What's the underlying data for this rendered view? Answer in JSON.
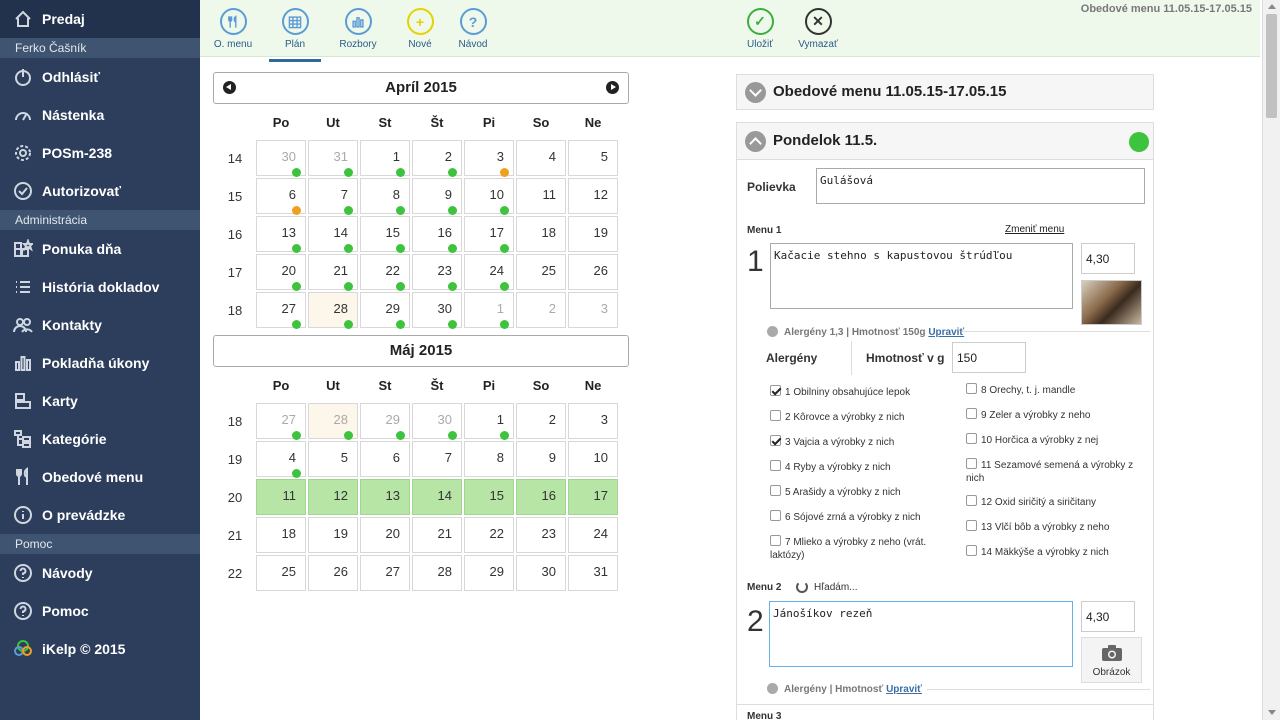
{
  "sidebar": {
    "items": [
      {
        "label": "Predaj",
        "icon": "home-icon"
      },
      {
        "section": "Ferko Čašník"
      },
      {
        "label": "Odhlásiť",
        "icon": "power-icon"
      },
      {
        "label": "Nástenka",
        "icon": "dashboard-icon"
      },
      {
        "label": "POSm-238",
        "icon": "gear-icon"
      },
      {
        "label": "Autorizovať",
        "icon": "check-circle-icon"
      },
      {
        "section": "Administrácia"
      },
      {
        "label": "Ponuka dňa",
        "icon": "blocks-star-icon"
      },
      {
        "label": "História dokladov",
        "icon": "list-icon"
      },
      {
        "label": "Kontakty",
        "icon": "users-icon"
      },
      {
        "label": "Pokladňa úkony",
        "icon": "bar-chart-icon"
      },
      {
        "label": "Karty",
        "icon": "cards-icon"
      },
      {
        "label": "Kategórie",
        "icon": "tree-icon"
      },
      {
        "label": "Obedové menu",
        "icon": "cutlery-icon"
      },
      {
        "label": "O prevádzke",
        "icon": "info-icon"
      },
      {
        "section": "Pomoc"
      },
      {
        "label": "Návody",
        "icon": "question-icon"
      },
      {
        "label": "Pomoc",
        "icon": "question-icon"
      },
      {
        "label": "iKelp © 2015",
        "icon": "ikelp-logo-icon"
      }
    ]
  },
  "toolbar": {
    "buttons": [
      {
        "label": "O. menu",
        "icon": "cutlery-icon",
        "color": "#5c9bd6"
      },
      {
        "label": "Plán",
        "icon": "calendar-icon",
        "color": "#5c9bd6",
        "active": true
      },
      {
        "label": "Rozbory",
        "icon": "bar-chart-icon",
        "color": "#5c9bd6"
      },
      {
        "label": "Nové",
        "icon": "plus-icon",
        "color": "#e5d200"
      },
      {
        "label": "Návod",
        "icon": "question-icon",
        "color": "#5c9bd6"
      },
      {
        "label": "Uložiť",
        "icon": "check-icon",
        "color": "#3dae3d"
      },
      {
        "label": "Vymazať",
        "icon": "close-icon",
        "color": "#333333"
      }
    ],
    "title": "Obedové menu 11.05.15-17.05.15"
  },
  "calendar": {
    "weekdays": [
      "Po",
      "Ut",
      "St",
      "Št",
      "Pi",
      "So",
      "Ne"
    ],
    "months": [
      {
        "title": "Apríl 2015",
        "weeks": [
          {
            "no": "14",
            "days": [
              {
                "d": "30",
                "other": true,
                "dot": "green"
              },
              {
                "d": "31",
                "other": true,
                "dot": "green"
              },
              {
                "d": "1",
                "dot": "green"
              },
              {
                "d": "2",
                "dot": "green"
              },
              {
                "d": "3",
                "dot": "orange"
              },
              {
                "d": "4"
              },
              {
                "d": "5"
              }
            ]
          },
          {
            "no": "15",
            "days": [
              {
                "d": "6",
                "dot": "orange"
              },
              {
                "d": "7",
                "dot": "green"
              },
              {
                "d": "8",
                "dot": "green"
              },
              {
                "d": "9",
                "dot": "green"
              },
              {
                "d": "10",
                "dot": "green"
              },
              {
                "d": "11"
              },
              {
                "d": "12"
              }
            ]
          },
          {
            "no": "16",
            "days": [
              {
                "d": "13",
                "dot": "green"
              },
              {
                "d": "14",
                "dot": "green"
              },
              {
                "d": "15",
                "dot": "green"
              },
              {
                "d": "16",
                "dot": "green"
              },
              {
                "d": "17",
                "dot": "green"
              },
              {
                "d": "18"
              },
              {
                "d": "19"
              }
            ]
          },
          {
            "no": "17",
            "days": [
              {
                "d": "20",
                "dot": "green"
              },
              {
                "d": "21",
                "dot": "green"
              },
              {
                "d": "22",
                "dot": "green"
              },
              {
                "d": "23",
                "dot": "green"
              },
              {
                "d": "24",
                "dot": "green"
              },
              {
                "d": "25"
              },
              {
                "d": "26"
              }
            ]
          },
          {
            "no": "18",
            "days": [
              {
                "d": "27",
                "dot": "green"
              },
              {
                "d": "28",
                "today": true,
                "dot": "green"
              },
              {
                "d": "29",
                "dot": "green"
              },
              {
                "d": "30",
                "dot": "green"
              },
              {
                "d": "1",
                "other": true,
                "dot": "green"
              },
              {
                "d": "2",
                "other": true
              },
              {
                "d": "3",
                "other": true
              }
            ]
          }
        ]
      },
      {
        "title": "Máj 2015",
        "weeks": [
          {
            "no": "18",
            "days": [
              {
                "d": "27",
                "other": true,
                "dot": "green"
              },
              {
                "d": "28",
                "other": true,
                "today": true,
                "dot": "green"
              },
              {
                "d": "29",
                "other": true,
                "dot": "green"
              },
              {
                "d": "30",
                "other": true,
                "dot": "green"
              },
              {
                "d": "1",
                "dot": "green"
              },
              {
                "d": "2"
              },
              {
                "d": "3"
              }
            ]
          },
          {
            "no": "19",
            "days": [
              {
                "d": "4",
                "dot": "green"
              },
              {
                "d": "5"
              },
              {
                "d": "6"
              },
              {
                "d": "7"
              },
              {
                "d": "8"
              },
              {
                "d": "9"
              },
              {
                "d": "10"
              }
            ]
          },
          {
            "no": "20",
            "days": [
              {
                "d": "11",
                "hl": true
              },
              {
                "d": "12",
                "hl": true
              },
              {
                "d": "13",
                "hl": true
              },
              {
                "d": "14",
                "hl": true
              },
              {
                "d": "15",
                "hl": true
              },
              {
                "d": "16",
                "hl": true
              },
              {
                "d": "17",
                "hl": true
              }
            ]
          },
          {
            "no": "21",
            "days": [
              {
                "d": "18"
              },
              {
                "d": "19"
              },
              {
                "d": "20"
              },
              {
                "d": "21"
              },
              {
                "d": "22"
              },
              {
                "d": "23"
              },
              {
                "d": "24"
              }
            ]
          },
          {
            "no": "22",
            "days": [
              {
                "d": "25"
              },
              {
                "d": "26"
              },
              {
                "d": "27"
              },
              {
                "d": "28"
              },
              {
                "d": "29"
              },
              {
                "d": "30"
              },
              {
                "d": "31"
              }
            ]
          }
        ]
      }
    ],
    "dot_colors": {
      "green": "#3dc33d",
      "orange": "#f0a020"
    }
  },
  "menu_panel": {
    "week_title": "Obedové menu 11.05.15-17.05.15",
    "day_title": "Pondelok 11.5.",
    "status_color": "#3dc33d",
    "soup_label": "Polievka",
    "soup_value": "Gulášová",
    "menu1": {
      "label": "Menu 1",
      "number": "1",
      "change_link": "Zmeniť menu",
      "value": "Kačacie stehno s kapustovou štrúdľou",
      "price": "4,30",
      "info": "Alergény 1,3 | Hmotnosť 150g",
      "edit_link": "Upraviť",
      "allergens_label": "Alergény",
      "weight_label": "Hmotnosť v g",
      "weight_value": "150"
    },
    "allergens": [
      {
        "label": "1 Obilniny obsahujúce lepok",
        "checked": true
      },
      {
        "label": "2 Kôrovce a výrobky z nich",
        "checked": false
      },
      {
        "label": "3 Vajcia a výrobky z nich",
        "checked": true
      },
      {
        "label": "4 Ryby a výrobky z nich",
        "checked": false
      },
      {
        "label": "5 Arašidy a výrobky z nich",
        "checked": false
      },
      {
        "label": "6 Sójové zrná a výrobky z nich",
        "checked": false
      },
      {
        "label": "7 Mlieko a výrobky z neho (vrát. laktózy)",
        "checked": false
      },
      {
        "label": "8 Orechy, t. j. mandle",
        "checked": false
      },
      {
        "label": "9 Zeler a výrobky z neho",
        "checked": false
      },
      {
        "label": "10 Horčica a výrobky z nej",
        "checked": false
      },
      {
        "label": "11 Sezamové semená a výrobky z nich",
        "checked": false
      },
      {
        "label": "12 Oxid siričitý a siričitany",
        "checked": false
      },
      {
        "label": "13 Vlčí bôb a výrobky z neho",
        "checked": false
      },
      {
        "label": "14 Mäkkýše a výrobky z nich",
        "checked": false
      }
    ],
    "menu2": {
      "label": "Menu 2",
      "number": "2",
      "searching": "Hľadám...",
      "value": "Jánošíkov rezeň",
      "price": "4,30",
      "image_label": "Obrázok",
      "info": "Alergény | Hmotnosť",
      "edit_link": "Upraviť"
    },
    "menu3_label": "Menu 3"
  }
}
